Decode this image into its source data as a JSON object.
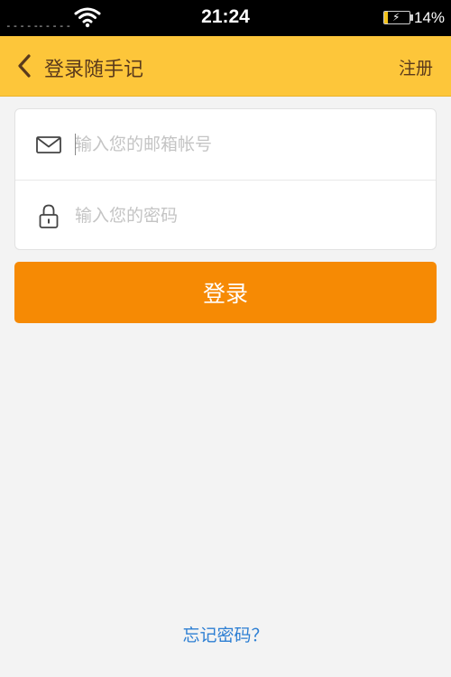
{
  "status_bar": {
    "signal_left": "-----",
    "signal_right": "-----",
    "time": "21:24",
    "battery_level": 0.14,
    "battery_text": "14%",
    "icons": [
      "wifi-icon",
      "battery-charging-icon"
    ]
  },
  "header": {
    "back_icon": "chevron-left-icon",
    "title": "登录随手记",
    "register_label": "注册",
    "background_color": "#fdc63a",
    "text_color": "#5a3a1c"
  },
  "form": {
    "email": {
      "icon": "mail-icon",
      "placeholder": "输入您的邮箱帐号",
      "value": ""
    },
    "password": {
      "icon": "lock-icon",
      "placeholder": "输入您的密码",
      "value": ""
    }
  },
  "login_button": {
    "label": "登录",
    "color": "#f68a04"
  },
  "forgot_password": {
    "label": "忘记密码？",
    "color": "#2d7fd3"
  }
}
